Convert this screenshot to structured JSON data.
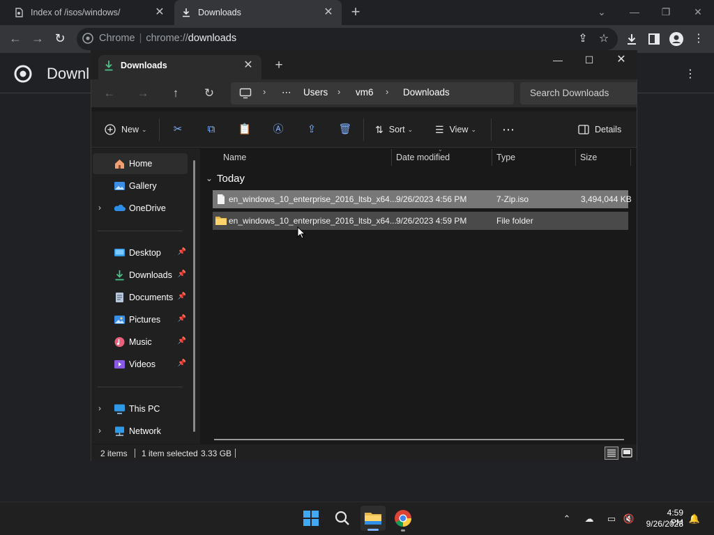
{
  "chrome": {
    "tabs": [
      {
        "label": "Index of /isos/windows/",
        "active": false
      },
      {
        "label": "Downloads",
        "active": true
      }
    ],
    "omnibox": {
      "scheme_label": "Chrome",
      "url_prefix": "chrome://",
      "url_host": "downloads"
    },
    "page_title": "Downl"
  },
  "explorer": {
    "tab_label": "Downloads",
    "breadcrumb": [
      "Users",
      "vm6",
      "Downloads"
    ],
    "search_placeholder": "Search Downloads",
    "commands": {
      "new": "New",
      "sort": "Sort",
      "view": "View",
      "details": "Details"
    },
    "nav": {
      "home": "Home",
      "gallery": "Gallery",
      "onedrive": "OneDrive",
      "quick_access": [
        {
          "label": "Desktop"
        },
        {
          "label": "Downloads"
        },
        {
          "label": "Documents"
        },
        {
          "label": "Pictures"
        },
        {
          "label": "Music"
        },
        {
          "label": "Videos"
        }
      ],
      "this_pc": "This PC",
      "network": "Network"
    },
    "columns": {
      "name": "Name",
      "date": "Date modified",
      "type": "Type",
      "size": "Size"
    },
    "group": "Today",
    "files": [
      {
        "name": "en_windows_10_enterprise_2016_ltsb_x64...",
        "date": "9/26/2023 4:56 PM",
        "type": "7-Zip.iso",
        "size": "3,494,044 KB",
        "icon": "file-icon",
        "selected": true
      },
      {
        "name": "en_windows_10_enterprise_2016_ltsb_x64...",
        "date": "9/26/2023 4:59 PM",
        "type": "File folder",
        "size": "",
        "icon": "folder-icon",
        "selected": false
      }
    ],
    "status": {
      "items": "2 items",
      "selected": "1 item selected",
      "selected_size": "3.33 GB"
    }
  },
  "taskbar": {
    "time": "4:59 PM",
    "date": "9/26/2023"
  },
  "colors": {
    "accent": "#7fb0ff",
    "chrome_bg": "#202124",
    "explorer_bg": "#191919",
    "selected_row": "#777777",
    "hover_row": "#4a4a4a"
  }
}
